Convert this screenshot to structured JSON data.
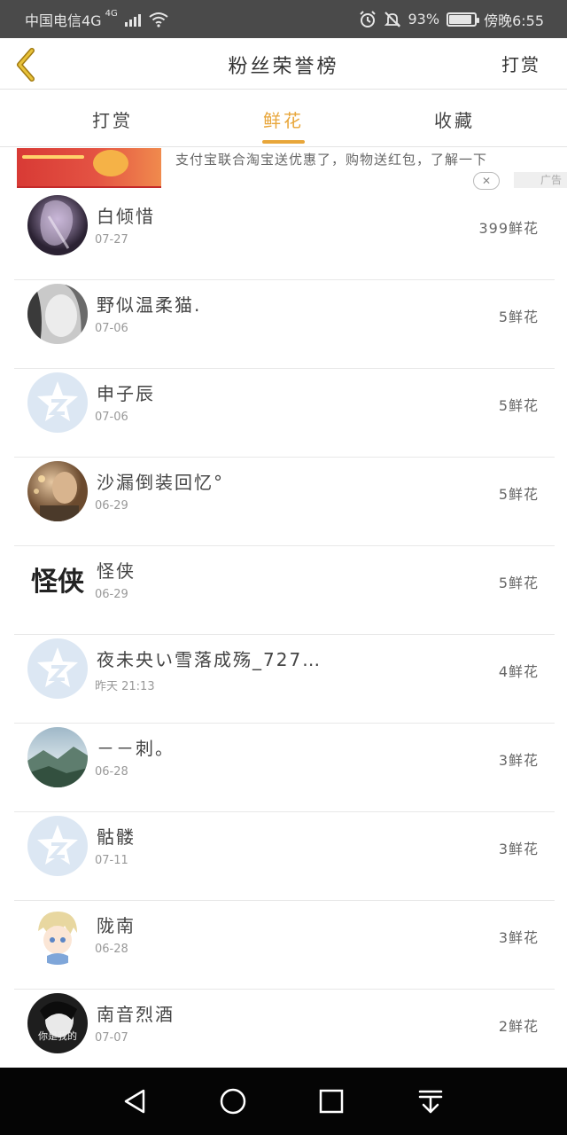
{
  "status_bar": {
    "carrier": "中国电信4G",
    "network_badge": "4G",
    "battery_percent": "93%",
    "time": "傍晚6:55",
    "icons": [
      "signal-icon",
      "wifi-icon",
      "alarm-icon",
      "mute-icon",
      "battery-icon"
    ]
  },
  "header": {
    "title": "粉丝荣誉榜",
    "action_label": "打赏",
    "back_icon": "chevron-left-icon",
    "accent_color": "#e8a63a"
  },
  "tabs": [
    {
      "label": "打赏",
      "active": false
    },
    {
      "label": "鲜花",
      "active": true
    },
    {
      "label": "收藏",
      "active": false
    }
  ],
  "ad": {
    "text": "支付宝联合淘宝送优惠了，购物送红包，了解一下",
    "close_label": "✕",
    "tag": "广告"
  },
  "fans": [
    {
      "name": "白倾惜",
      "date": "07-27",
      "count": "399鲜花"
    },
    {
      "name": "野似温柔猫.",
      "date": "07-06",
      "count": "5鲜花"
    },
    {
      "name": "申子辰",
      "date": "07-06",
      "count": "5鲜花"
    },
    {
      "name": "沙漏倒装回忆°",
      "date": "06-29",
      "count": "5鲜花"
    },
    {
      "name": "怪侠",
      "date": "06-29",
      "count": "5鲜花"
    },
    {
      "name": "夜未央い雪落成殇_727…",
      "date": "昨天 21:13",
      "count": "4鲜花"
    },
    {
      "name": "－－刺。",
      "date": "06-28",
      "count": "3鲜花"
    },
    {
      "name": "骷髅",
      "date": "07-11",
      "count": "3鲜花"
    },
    {
      "name": "陇南",
      "date": "06-28",
      "count": "3鲜花"
    },
    {
      "name": "南音烈酒",
      "date": "07-07",
      "count": "2鲜花"
    }
  ],
  "avatar_text": {
    "guaixia": "怪侠",
    "nanyin": "你是我的"
  },
  "nav": {
    "icons": [
      "back-triangle-icon",
      "home-circle-icon",
      "recents-square-icon",
      "notification-pull-icon"
    ]
  }
}
